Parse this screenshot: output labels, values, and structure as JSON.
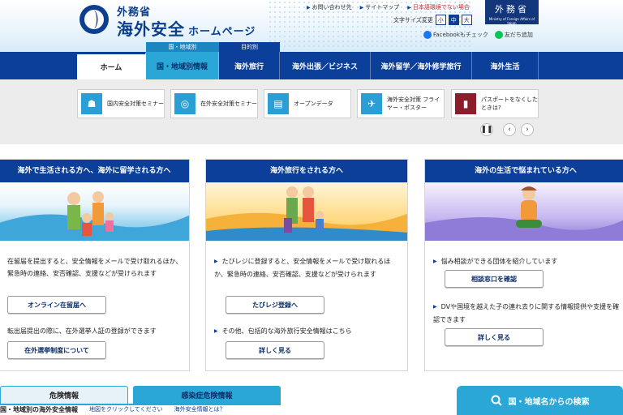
{
  "header": {
    "site_small": "外務省",
    "site_big": "海外安全",
    "site_sub": "ホームページ",
    "util_links": [
      "お問い合わせ先",
      "サイトマップ",
      "日本語環境でない場合"
    ],
    "fontsize_label": "文字サイズ変更",
    "fontsize_options": [
      "小",
      "中",
      "大"
    ],
    "mofa_jp": "外務省",
    "mofa_en": "Ministry of Foreign Affairs of Japan",
    "facebook_label": "Facebookもチェック",
    "line_label": "友だち追加"
  },
  "tags": {
    "country": "国・地域別",
    "purpose": "目的別"
  },
  "nav": [
    "ホーム",
    "国・地域別情報",
    "海外旅行",
    "海外出張／ビジネス",
    "海外留学／海外修学旅行",
    "海外生活"
  ],
  "quick_links": [
    {
      "icon": "seminar-icon",
      "label": "国内安全対策セミナー"
    },
    {
      "icon": "overseas-seminar-icon",
      "label": "在外安全対策セミナー"
    },
    {
      "icon": "document-icon",
      "label": "オープンデータ"
    },
    {
      "icon": "airplane-icon",
      "label": "海外安全対策 フライヤー・ポスター"
    },
    {
      "icon": "passport-icon",
      "label": "パスポートをなくしたときは?"
    }
  ],
  "cards": [
    {
      "title": "海外で生活される方へ、海外に留学される方へ",
      "text1": "在留届を提出すると、安全情報をメールで受け取れるほか、緊急時の連絡、安否確認、支援などが受けられます",
      "button1": "オンライン在留届へ",
      "text2": "転出届提出の際に、在外選挙人証の登録ができます",
      "button2": "在外選挙制度について"
    },
    {
      "title": "海外旅行をされる方へ",
      "text1": "たびレジに登録すると、安全情報をメールで受け取れるほか、緊急時の連絡、安否確認、支援などが受けられます",
      "button1": "たびレジ登録へ",
      "text2": "その他、包括的な海外旅行安全情報はこちら",
      "button2": "詳しく見る"
    },
    {
      "title": "海外の生活で悩まれている方へ",
      "text1": "悩み相談ができる団体を紹介しています",
      "button1": "相談窓口を確認",
      "text2": "DVや国境を越えた子の連れ去りに関する情報提供や支援を確認できます",
      "button2": "詳しく見る"
    }
  ],
  "bottom": {
    "tab1": "危険情報",
    "tab2": "感染症危険情報",
    "line1": "国・地域別の海外安全情報",
    "line2": "地図をクリックしてください",
    "line3": "海外安全情報とは？",
    "search": "国・地域名からの検索"
  }
}
